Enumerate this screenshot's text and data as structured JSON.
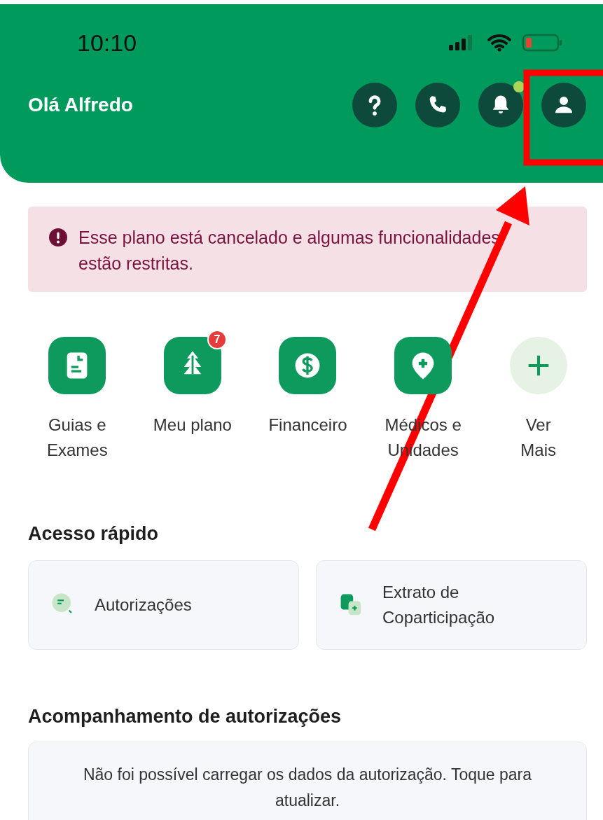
{
  "status_bar": {
    "time": "10:10"
  },
  "header": {
    "greeting": "Olá Alfredo",
    "actions": [
      {
        "kind": "help"
      },
      {
        "kind": "phone"
      },
      {
        "kind": "bell",
        "dot": true
      },
      {
        "kind": "profile"
      }
    ]
  },
  "alert": {
    "text": "Esse plano está cancelado e algumas funcionalidades estão restritas."
  },
  "shortcuts": [
    {
      "kind": "guides",
      "label_lines": [
        "Guias e",
        "Exames"
      ]
    },
    {
      "kind": "plan",
      "label_lines": [
        "Meu plano"
      ],
      "badge": "7"
    },
    {
      "kind": "finance",
      "label_lines": [
        "Financeiro"
      ]
    },
    {
      "kind": "doctors",
      "label_lines": [
        "Médicos e",
        "Unidades"
      ]
    },
    {
      "kind": "more",
      "label_lines": [
        "Ver",
        "Mais"
      ]
    }
  ],
  "quick_access": {
    "title": "Acesso rápido",
    "cards": [
      {
        "kind": "search",
        "label_lines": [
          "Autorizações"
        ]
      },
      {
        "kind": "statement",
        "label_lines": [
          "Extrato de",
          "Coparticipação"
        ]
      }
    ]
  },
  "tracking": {
    "title": "Acompanhamento de autorizações",
    "message": "Não foi possível carregar os dados da autorização. Toque para atualizar."
  }
}
